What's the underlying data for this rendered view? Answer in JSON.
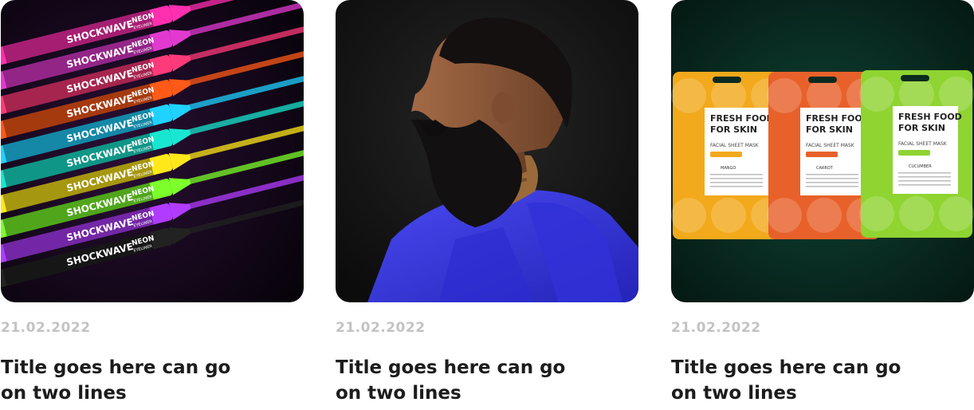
{
  "articles": [
    {
      "date": "21.02.2022",
      "title": "Title goes here can go on two lines",
      "image": {
        "subject": "neon eyeliner pencils",
        "bg_color": "#1c0b23",
        "pencil_colors": [
          "#ff2fb0",
          "#e23ad0",
          "#ff3a7a",
          "#ff5a18",
          "#1fd2ff",
          "#19e6d0",
          "#ffe81a",
          "#7cff2a",
          "#b13cff",
          "#222222"
        ],
        "pencil_brand": "SHOCKWAVE",
        "pencil_label": "NEON",
        "pencil_sublabel": "EYELINER"
      }
    },
    {
      "date": "21.02.2022",
      "title": "Title goes here can go on two lines",
      "image": {
        "subject": "bearded man in blue coat profile",
        "bg_color": "#141414",
        "coat_color": "#3a3ae6",
        "scarf_color": "#9a6a3a",
        "skin_color": "#8a5a3c"
      }
    },
    {
      "date": "21.02.2022",
      "title": "Title goes here can go on two lines",
      "image": {
        "subject": "facial sheet mask packs",
        "bg_color": "#07271f",
        "packs": [
          {
            "color": "#f2a91c",
            "headline": "FRESH FOOD FOR SKIN",
            "sub": "FACIAL SHEET MASK",
            "variant": "MANGO"
          },
          {
            "color": "#e8612a",
            "headline": "FRESH FOOD FOR SKIN",
            "sub": "FACIAL SHEET MASK",
            "variant": "CARROT"
          },
          {
            "color": "#8fd431",
            "headline": "FRESH FOOD FOR SKIN",
            "sub": "FACIAL SHEET MASK",
            "variant": "CUCUMBER"
          }
        ]
      }
    }
  ]
}
